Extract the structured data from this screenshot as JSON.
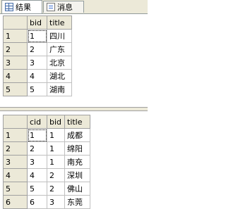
{
  "tabs": [
    {
      "label": "结果",
      "icon": "grid-icon",
      "active": true
    },
    {
      "label": "消息",
      "icon": "message-icon",
      "active": false
    }
  ],
  "grid1": {
    "columns": [
      "bid",
      "title"
    ],
    "rows": [
      {
        "num": "1",
        "bid": "1",
        "title": "四川"
      },
      {
        "num": "2",
        "bid": "2",
        "title": "广东"
      },
      {
        "num": "3",
        "bid": "3",
        "title": "北京"
      },
      {
        "num": "4",
        "bid": "4",
        "title": "湖北"
      },
      {
        "num": "5",
        "bid": "5",
        "title": "湖南"
      }
    ]
  },
  "grid2": {
    "columns": [
      "cid",
      "bid",
      "title"
    ],
    "rows": [
      {
        "num": "1",
        "cid": "1",
        "bid": "1",
        "title": "成都"
      },
      {
        "num": "2",
        "cid": "2",
        "bid": "1",
        "title": "绵阳"
      },
      {
        "num": "3",
        "cid": "3",
        "bid": "1",
        "title": "南充"
      },
      {
        "num": "4",
        "cid": "4",
        "bid": "2",
        "title": "深圳"
      },
      {
        "num": "5",
        "cid": "5",
        "bid": "2",
        "title": "佛山"
      },
      {
        "num": "6",
        "cid": "6",
        "bid": "3",
        "title": "东莞"
      }
    ]
  }
}
